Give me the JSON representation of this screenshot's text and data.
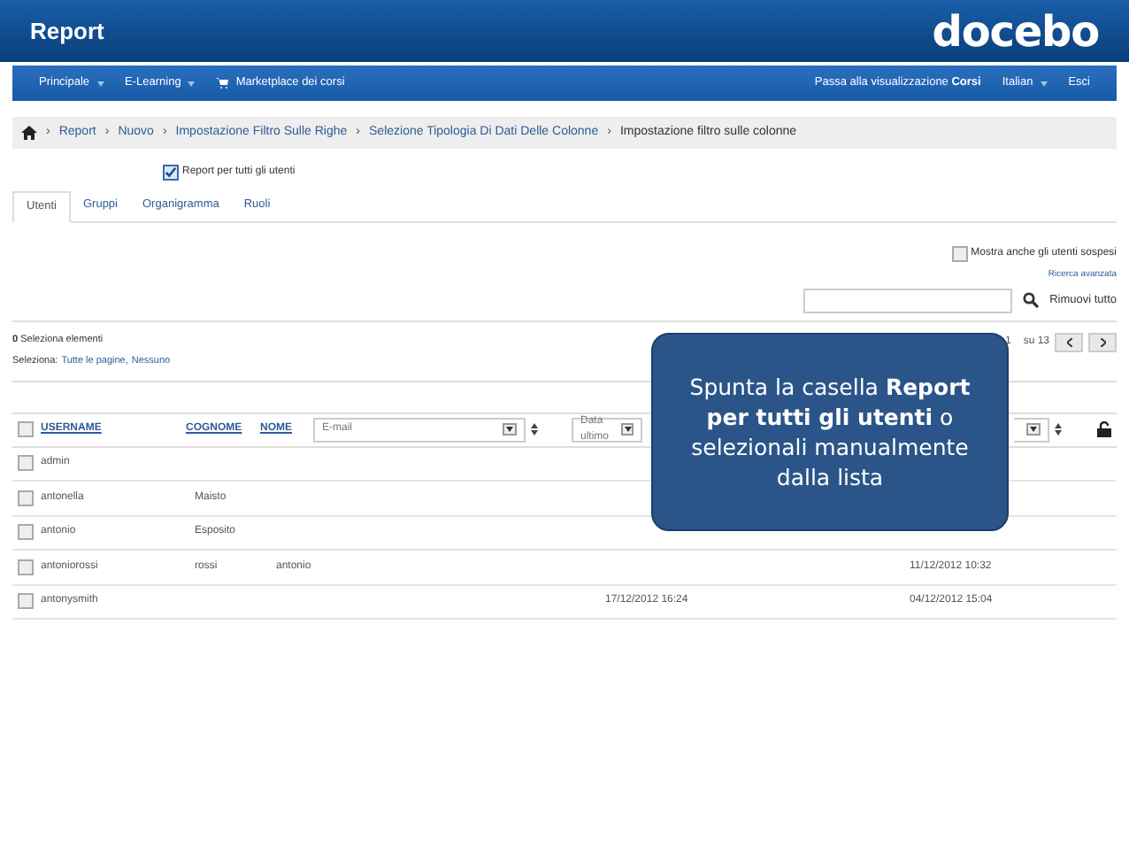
{
  "header": {
    "title": "Report",
    "logo": "docebo"
  },
  "nav": {
    "left": [
      {
        "label": "Principale",
        "caret": true,
        "kind": "menu"
      },
      {
        "label": "E-Learning",
        "caret": true,
        "kind": "menu"
      },
      {
        "label": "Marketplace dei corsi",
        "caret": false,
        "kind": "cart"
      }
    ],
    "right": [
      {
        "label": "Passa alla visualizzazione ",
        "bold": "Corsi",
        "caret": false
      },
      {
        "label": "Italian",
        "caret": true
      },
      {
        "label": "Esci",
        "caret": false
      }
    ]
  },
  "breadcrumb": {
    "separator": "›",
    "items": [
      "Report",
      "Nuovo",
      "Impostazione Filtro Sulle Righe",
      "Selezione Tipologia Di Dati Delle Colonne"
    ],
    "current": "Impostazione filtro sulle colonne"
  },
  "all_users": {
    "label": "Report per tutti gli utenti",
    "checked": true
  },
  "tabs": [
    {
      "label": "Utenti",
      "selected": true
    },
    {
      "label": "Gruppi",
      "selected": false
    },
    {
      "label": "Organigramma",
      "selected": false
    },
    {
      "label": "Ruoli",
      "selected": false
    }
  ],
  "suspended": {
    "label": "Mostra anche gli utenti sospesi",
    "checked": false
  },
  "advanced_search": "Ricerca avanzata",
  "remove_all": "Rimuovi tutto",
  "selection": {
    "count": "0",
    "count_label": "Seleziona elementi",
    "prefix": "Seleziona:",
    "all_pages": "Tutte le pagine,",
    "none": "Nessuno"
  },
  "pagination": {
    "page": "1",
    "total": "su 13"
  },
  "table": {
    "columns": [
      "USERNAME",
      "COGNOME",
      "NOME"
    ],
    "select_all_checked": false,
    "filters": [
      "E-mail",
      "Data ultimo"
    ],
    "rows": [
      {
        "checked": false,
        "cells": [
          "admin",
          "",
          "",
          "",
          "",
          ""
        ]
      },
      {
        "checked": false,
        "cells": [
          "antonella",
          "Maisto",
          "",
          "",
          "",
          ""
        ]
      },
      {
        "checked": false,
        "cells": [
          "antonio",
          "Esposito",
          "",
          "",
          "",
          ""
        ]
      },
      {
        "checked": false,
        "cells": [
          "antoniorossi",
          "rossi",
          "antonio",
          "",
          "",
          "11/12/2012 10:32"
        ]
      },
      {
        "checked": false,
        "cells": [
          "antonysmith",
          "",
          "",
          "",
          "17/12/2012 16:24",
          "04/12/2012 15:04"
        ]
      }
    ]
  },
  "callout": {
    "text": "Spunta la casella **Report per tutti gli utenti** o selezionali manualmente dalla lista"
  }
}
